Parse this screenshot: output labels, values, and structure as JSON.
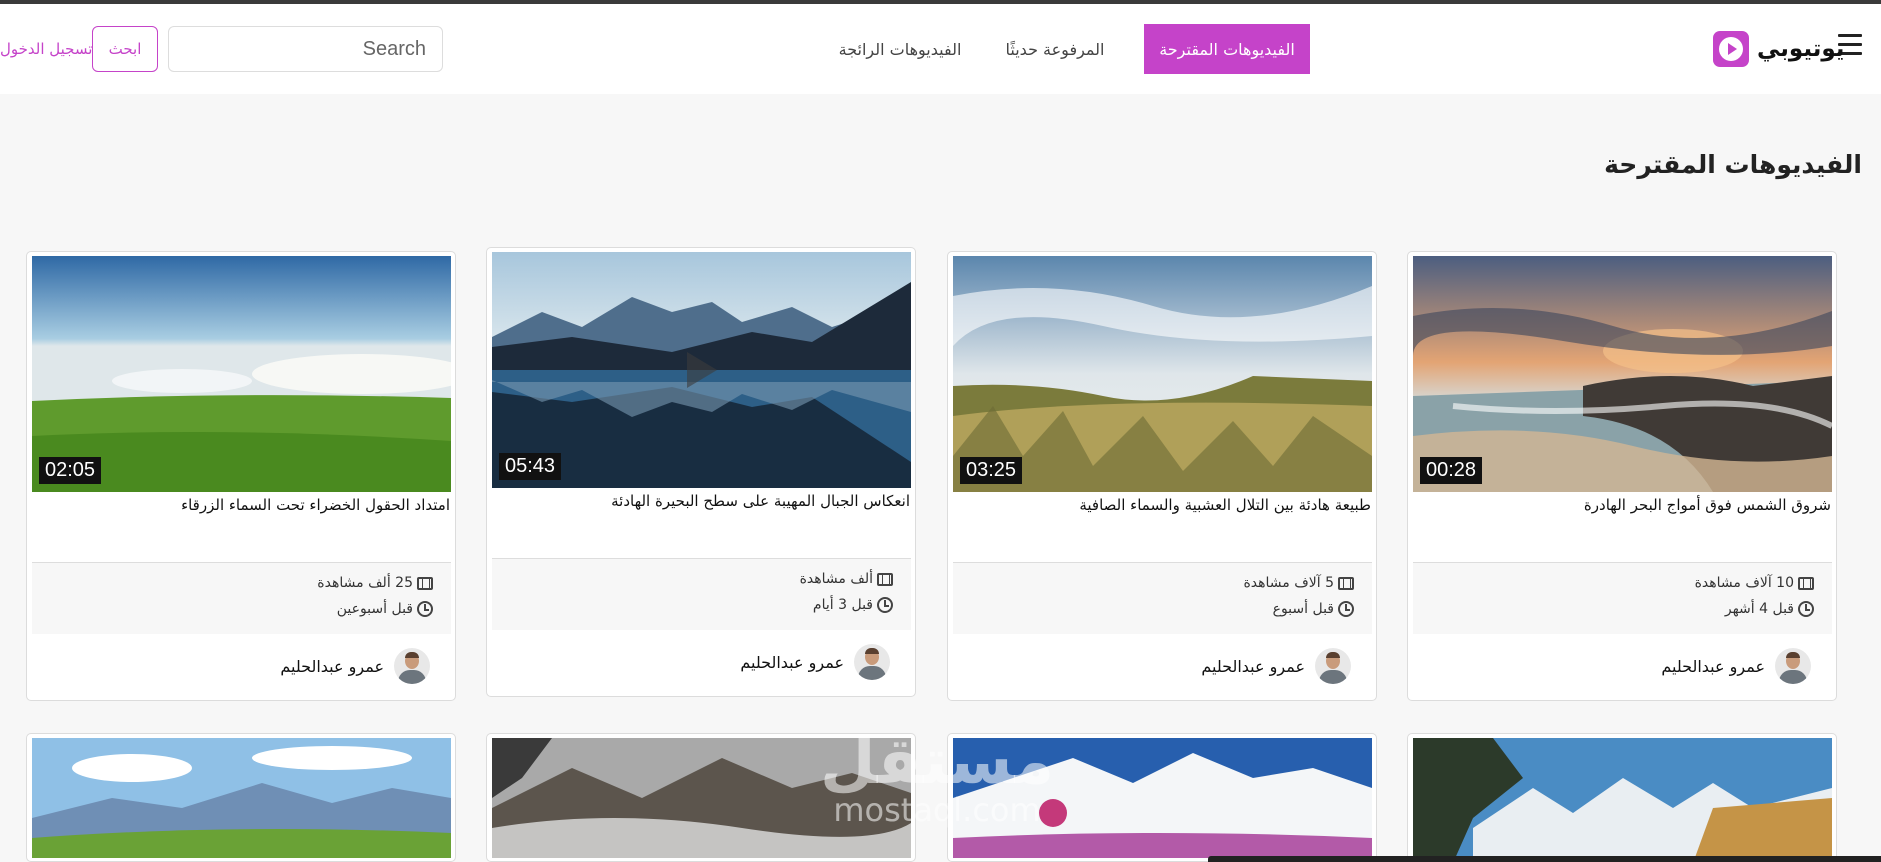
{
  "nav": {
    "brand": "يوتيوبي",
    "tabs": [
      "الفيديوهات المقترحة",
      "المرفوعة حديثًا",
      "الفيديوهات الرائجة"
    ],
    "search_placeholder": "Search",
    "search_button": "ابحث",
    "login": "تسجيل الدخول"
  },
  "section_title": "الفيديوهات المقترحة",
  "videos": [
    {
      "title": "شروق الشمس فوق أمواج البحر الهادرة",
      "duration": "00:28",
      "views": "10 آلاف مشاهدة",
      "date": "قبل 4 أشهر",
      "author": "عمرو عبدالحليم"
    },
    {
      "title": "طبيعة هادئة بين التلال العشبية والسماء الصافية",
      "duration": "03:25",
      "views": "5 آلاف مشاهدة",
      "date": "قبل أسبوع",
      "author": "عمرو عبدالحليم"
    },
    {
      "title": "انعكاس الجبال المهيبة على سطح البحيرة الهادئة",
      "duration": "05:43",
      "views": "ألف مشاهدة",
      "date": "قبل 3 أيام",
      "author": "عمرو عبدالحليم"
    },
    {
      "title": "امتداد الحقول الخضراء تحت السماء الزرقاء",
      "duration": "02:05",
      "views": "25 ألف مشاهدة",
      "date": "قبل أسبوعين",
      "author": "عمرو عبدالحليم"
    }
  ],
  "watermark": {
    "line1": "مستقل",
    "line2": "mostaql.com"
  },
  "colors": {
    "accent": "#c543c9",
    "background": "#f7f7f7"
  }
}
